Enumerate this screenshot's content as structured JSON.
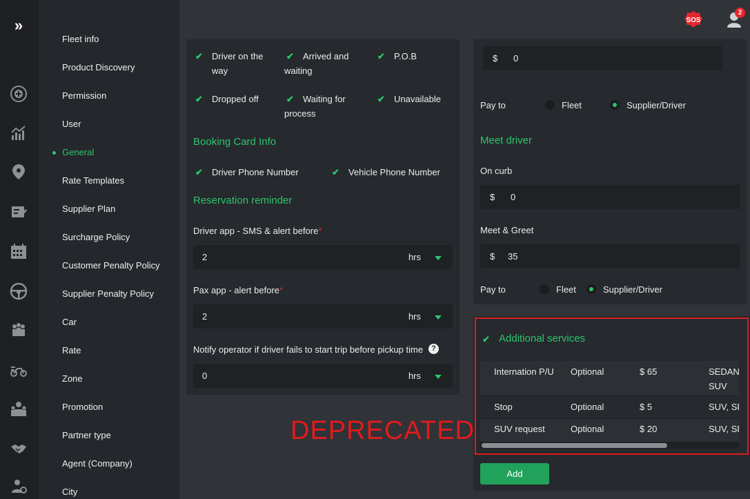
{
  "nav": {
    "items": [
      {
        "label": "Fleet info"
      },
      {
        "label": "Product Discovery"
      },
      {
        "label": "Permission"
      },
      {
        "label": "User"
      },
      {
        "label": "General"
      },
      {
        "label": "Rate Templates"
      },
      {
        "label": "Supplier Plan"
      },
      {
        "label": "Surcharge Policy"
      },
      {
        "label": "Customer Penalty Policy"
      },
      {
        "label": "Supplier Penalty Policy"
      },
      {
        "label": "Car"
      },
      {
        "label": "Rate"
      },
      {
        "label": "Zone"
      },
      {
        "label": "Promotion"
      },
      {
        "label": "Partner type"
      },
      {
        "label": "Agent (Company)"
      },
      {
        "label": "City"
      }
    ],
    "active": "General"
  },
  "header": {
    "sos_label": "SOS",
    "notification_count": "2"
  },
  "statuses": {
    "items": [
      {
        "label": "Driver on the way"
      },
      {
        "label": "Arrived and waiting"
      },
      {
        "label": "P.O.B"
      },
      {
        "label": "Dropped off"
      },
      {
        "label": "Waiting for process"
      },
      {
        "label": "Unavailable"
      }
    ]
  },
  "booking_card": {
    "title": "Booking Card Info",
    "driver_phone": "Driver Phone Number",
    "vehicle_phone": "Vehicle Phone Number"
  },
  "reminder": {
    "title": "Reservation reminder",
    "driver_label": "Driver app - SMS & alert before",
    "driver_value": "2",
    "driver_unit": "hrs",
    "pax_label": "Pax app - alert before",
    "pax_value": "2",
    "pax_unit": "hrs",
    "notify_label": "Notify operator if driver fails to start trip before pickup time",
    "notify_value": "0",
    "notify_unit": "hrs",
    "required_mark": "*",
    "help_glyph": "?"
  },
  "right": {
    "top_currency": "$",
    "top_amount": "0",
    "pay_to_label": "Pay to",
    "pay_fleet": "Fleet",
    "pay_supplier": "Supplier/Driver",
    "meet_title": "Meet driver",
    "on_curb_label": "On curb",
    "on_curb_currency": "$",
    "on_curb_amount": "0",
    "meet_greet_label": "Meet & Greet",
    "meet_greet_currency": "$",
    "meet_greet_amount": "35",
    "pay_to_label_2": "Pay to",
    "pay_fleet_2": "Fleet",
    "pay_supplier_2": "Supplier/Driver"
  },
  "additional": {
    "title": "Additional services",
    "rows": [
      {
        "name": "Internation P/U",
        "type": "Optional",
        "price": "$ 65",
        "cars_1": "SEDAN,",
        "cars_2": "SUV"
      },
      {
        "name": "Stop",
        "type": "Optional",
        "price": "$ 5",
        "cars_1": "SUV, SE"
      },
      {
        "name": "SUV request",
        "type": "Optional",
        "price": "$ 20",
        "cars_1": "SUV, SE"
      }
    ],
    "add_label": "Add"
  },
  "overlay": {
    "deprecated_text": "DEPRECATED",
    "color": "#e21b1b"
  },
  "colors": {
    "accent": "#2ec46e",
    "background": "#303338",
    "panel": "#26292d"
  }
}
